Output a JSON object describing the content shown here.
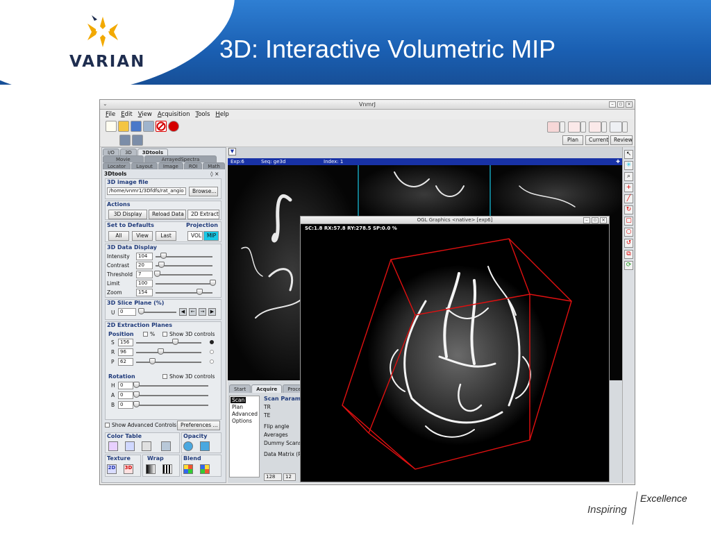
{
  "slide": {
    "title": "3D: Interactive Volumetric MIP",
    "brand": "VARIAN",
    "footer_inspiring": "Inspiring",
    "footer_excellence": "Excellence"
  },
  "window": {
    "title": "VnmrJ",
    "controls": [
      "–",
      "▫",
      "×"
    ],
    "menu": [
      "File",
      "Edit",
      "View",
      "Acquisition",
      "Tools",
      "Help"
    ],
    "buttons": {
      "plan": "Plan",
      "current": "Current",
      "review": "Review"
    }
  },
  "left_panel": {
    "tabs_row1": [
      "I/O",
      "3D",
      "3Dtools"
    ],
    "tabs_row2": [
      "Movie",
      "ArrayedSpectra"
    ],
    "tabs_row3": [
      "Locator",
      "Layout",
      "Image",
      "ROI",
      "Math"
    ],
    "panel_title": "3Dtools",
    "panel_title_ctl": "◊ ×",
    "image_file": {
      "title": "3D image file",
      "path": "/home/vnmr1/3Dfdfs/rat_angio",
      "browse": "Browse..."
    },
    "actions": {
      "title": "Actions",
      "buttons": [
        "3D Display",
        "Reload Data",
        "2D Extract"
      ]
    },
    "defaults": {
      "title": "Set to Defaults",
      "buttons": [
        "All",
        "View",
        "Last"
      ]
    },
    "projection": {
      "title": "Projection",
      "options": [
        "VOL",
        "MIP"
      ],
      "selected": "MIP"
    },
    "display": {
      "title": "3D Data Display",
      "rows": [
        {
          "label": "Intensity",
          "value": "104",
          "pos": 0.13
        },
        {
          "label": "Contrast",
          "value": "20",
          "pos": 0.1
        },
        {
          "label": "Threshold",
          "value": "7",
          "pos": 0.03
        },
        {
          "label": "Limit",
          "value": "100",
          "pos": 1.0
        },
        {
          "label": "Zoom",
          "value": "154",
          "pos": 0.77
        }
      ]
    },
    "slice_plane": {
      "title": "3D Slice Plane (%)",
      "label": "U",
      "value": "0",
      "pos": 0.0
    },
    "extraction": {
      "title": "2D Extraction Planes",
      "position_title": "Position",
      "percent": "%",
      "show3d": "Show 3D controls",
      "rows": [
        {
          "label": "S",
          "value": "156",
          "pos": 0.6
        },
        {
          "label": "R",
          "value": "96",
          "pos": 0.37
        },
        {
          "label": "P",
          "value": "62",
          "pos": 0.24
        }
      ],
      "rotation_title": "Rotation",
      "rotation_show3d": "Show 3D controls",
      "rotation_rows": [
        {
          "label": "H",
          "value": "0",
          "pos": 0.0
        },
        {
          "label": "A",
          "value": "0",
          "pos": 0.0
        },
        {
          "label": "B",
          "value": "0",
          "pos": 0.0
        }
      ]
    },
    "advanced": "Show Advanced Controls",
    "preferences": "Preferences ...",
    "color_table": "Color Table",
    "opacity": "Opacity",
    "texture": "Texture",
    "wrap": "Wrap",
    "blend": "Blend",
    "texture_2d": "2D",
    "texture_3d": "3D"
  },
  "viewer": {
    "exp": "Exp:6",
    "seq": "Seq: ge3d",
    "index": "Index: 1",
    "bottom_tabs": [
      "Start",
      "Acquire",
      "Process"
    ],
    "bottom_list": [
      "Scan",
      "Plan",
      "Advanced",
      "Options"
    ],
    "scan_params_title": "Scan Param",
    "params": [
      "TR",
      "TE",
      "Flip angle",
      "Averages",
      "Dummy Scans",
      "Data Matrix (R"
    ],
    "matrix_values": [
      "128",
      "12"
    ]
  },
  "ogl": {
    "title": "OGL Graphics <native> [exp6]",
    "info": "SC:1.8  RX:57.8  RY:278.5  SP:0.0 %"
  },
  "colors": {
    "header_blue": "#1a5fb2",
    "exp_bar": "#1832a6",
    "box_red": "#e01010",
    "accent_cyan": "#19c8e6"
  }
}
